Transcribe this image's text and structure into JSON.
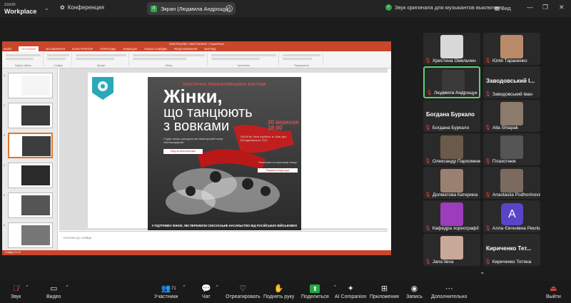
{
  "topbar": {
    "logo_line1": "zoom",
    "logo_line2": "Workplace",
    "conference_label": "Конференция",
    "screen_pill_label": "Экран (Людмила Андрощук)",
    "screen_pill_badge": "Л",
    "audio_note": "Звук оригинала для музыкантов выключен",
    "view_label": "Вид"
  },
  "powerpoint": {
    "title": "МИСТЕЦТВО І МАСТИНІНН - PowerPoint",
    "tabs": [
      "ФАЙЛ",
      "ОСНОВНЕ",
      "ВСТАВЛЕННЯ",
      "КОНСТРУКТОР",
      "ПЕРЕХОДИ",
      "АНІМАЦІЯ",
      "ПОКАЗ СЛАЙДІВ",
      "РЕЦЕНЗУВАННЯ",
      "ВИГЛЯД"
    ],
    "ribbon_groups": [
      "Буфер обміну",
      "Слайди",
      "Шрифт",
      "Абзац",
      "Креслення",
      "Редагування"
    ],
    "notes_placeholder": "Нотатки до слайда",
    "status_text": "Слайд 3 із 13",
    "thumb_numbers": [
      "1",
      "2",
      "3",
      "4",
      "5",
      "6"
    ]
  },
  "poster": {
    "top_line": "ПЛАСТИЧНА ТРАНСФОРМАЦІЙНА ВИСТАВА",
    "title_line1": "Жінки,",
    "title_line2": "що танцюють",
    "title_line3": "з вовками",
    "date_day": "30 вересня",
    "date_time": "18:00",
    "info_left": "Студія танцю для дорослих Аматорський театр «Метаморфоза»",
    "info_right": "НЦТМ ім. Леся Курбаса, м. Київ, вул. Володимирська, 23-Б",
    "button_invite": "Вхід за запрошенням",
    "rep_label": "Режисерка та хореограф театру",
    "rep_name": "Людмила Андрощук",
    "bottom_line": "У ПІДТРИМКУ ЖІНОК, ЯКІ ПЕРЕЖИЛИ СЕКСУАЛЬНЕ НАСИЛЬСТВО ВІД РОСІЙСЬКИХ ВІЙСЬКОВИХ"
  },
  "gallery": [
    {
      "name": "Христина Омельчен",
      "type": "video",
      "face": "#d8d8d8"
    },
    {
      "name": "Юлія Тараненко",
      "type": "video",
      "face": "#b88a6a"
    },
    {
      "name": "Людмила Андрощук",
      "type": "video",
      "face": "#3a3a3a",
      "speaking": true
    },
    {
      "name": "Заводовський Іван",
      "big": "Заводовський І...",
      "type": "name"
    },
    {
      "name": "Богдана Буркало",
      "big": "Богдана Буркало",
      "type": "name"
    },
    {
      "name": "Alla Shlapak",
      "type": "video",
      "face": "#8c7a6a"
    },
    {
      "name": "Олександр Пархоменко",
      "type": "video",
      "face": "#6a5a4a"
    },
    {
      "name": "Плахотнюк",
      "type": "video",
      "face": "#555555"
    },
    {
      "name": "Долматова Катерина",
      "type": "video",
      "face": "#9a8070"
    },
    {
      "name": "Anastasiia Podhorinova",
      "type": "video",
      "face": "#7a6a60"
    },
    {
      "name": "Кафедра хореографії",
      "type": "video",
      "face": "#9b3dbd"
    },
    {
      "name": "Алла Євгенівна Рекліцька",
      "type": "avatar",
      "letter": "A"
    },
    {
      "name": "Jana Ileva",
      "type": "video",
      "face": "#c8a898"
    },
    {
      "name": "Кириченко Тетяна",
      "big": "Кириченко  Тет...",
      "type": "name"
    }
  ],
  "toolbar": {
    "mute_label": "Звук",
    "video_label": "Видео",
    "participants_label": "Участники",
    "participants_count": "71",
    "chat_label": "Чат",
    "react_label": "Отреагировать",
    "raise_hand_label": "Поднять руку",
    "share_label": "Поделиться",
    "ai_label": "AI Companion",
    "apps_label": "Приложения",
    "record_label": "Запись",
    "more_label": "Дополнительно",
    "leave_label": "Выйти"
  }
}
